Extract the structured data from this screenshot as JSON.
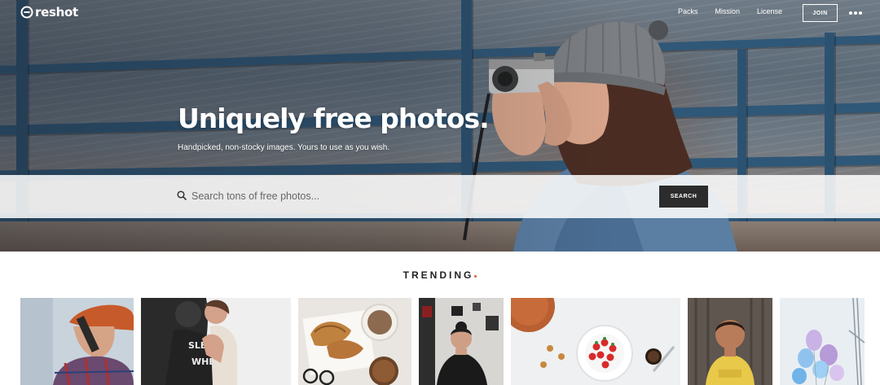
{
  "app": {
    "logo_text": "reshot"
  },
  "nav": {
    "links": [
      {
        "label": "Packs"
      },
      {
        "label": "Mission"
      },
      {
        "label": "License"
      }
    ],
    "join_label": "JOIN",
    "more_icon": "ellipsis-icon"
  },
  "hero": {
    "title": "Uniquely free photos.",
    "subtitle": "Handpicked, non-stocky images. Yours to use as you wish."
  },
  "search": {
    "placeholder": "Search tons of free photos...",
    "value": "",
    "button_label": "SEARCH",
    "icon": "search-icon"
  },
  "trending": {
    "heading": "TRENDING",
    "accent_color": "#e05a2b",
    "photos": [
      {
        "subject": "man in plaid shirt and hat on phone"
      },
      {
        "subject": "couple hugging"
      },
      {
        "subject": "croissants and coffee on table"
      },
      {
        "subject": "woman in black with hair bun"
      },
      {
        "subject": "strawberries on plate with coffee"
      },
      {
        "subject": "child in yellow shirt"
      },
      {
        "subject": "balloons"
      }
    ]
  }
}
